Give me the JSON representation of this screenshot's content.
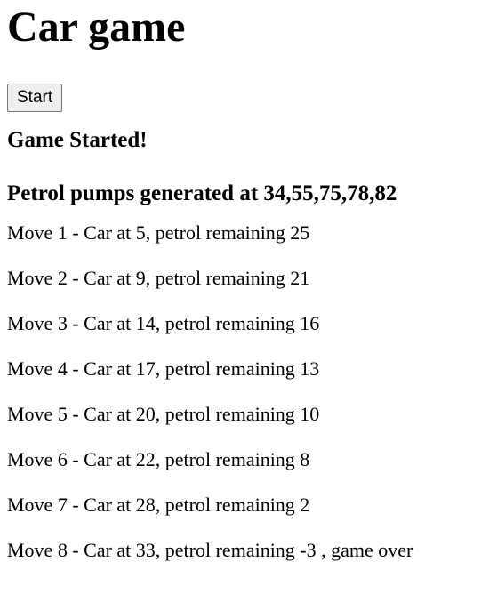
{
  "page": {
    "title": "Car game"
  },
  "controls": {
    "start_label": "Start"
  },
  "status": {
    "game_started": "Game Started!",
    "pumps_text": "Petrol pumps generated at 34,55,75,78,82"
  },
  "moves": [
    {
      "text": "Move 1 - Car at 5, petrol remaining 25"
    },
    {
      "text": "Move 2 - Car at 9, petrol remaining 21"
    },
    {
      "text": "Move 3 - Car at 14, petrol remaining 16"
    },
    {
      "text": "Move 4 - Car at 17, petrol remaining 13"
    },
    {
      "text": "Move 5 - Car at 20, petrol remaining 10"
    },
    {
      "text": "Move 6 - Car at 22, petrol remaining 8"
    },
    {
      "text": "Move 7 - Car at 28, petrol remaining 2"
    },
    {
      "text": "Move 8 - Car at 33, petrol remaining -3 , game over"
    }
  ]
}
